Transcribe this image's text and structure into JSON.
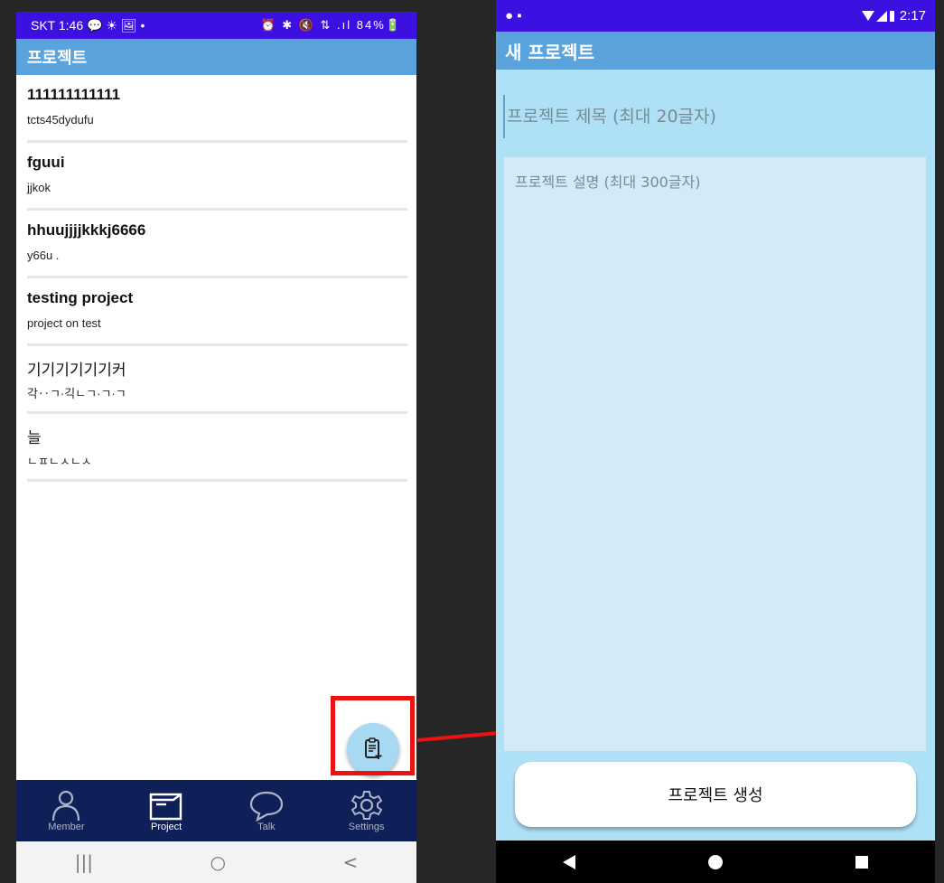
{
  "left": {
    "status": {
      "time": "SKT 1:46",
      "indicators": "💬 ☀ 🖼 •",
      "right": "⏰ ✱ 🔇 ⇅ .ıl 84%🔋"
    },
    "title": "프로젝트",
    "projects": [
      {
        "title": "111111111111",
        "desc": "tcts45dydufu"
      },
      {
        "title": "fguui",
        "desc": "jjkok"
      },
      {
        "title": "hhuujjjjkkkj6666",
        "desc": "y66u ."
      },
      {
        "title": "testing project",
        "desc": "project on test"
      },
      {
        "title": "기기기기기기커",
        "desc": "각‥ㄱ·긱ㄴㄱ·ㄱ·ㄱ"
      },
      {
        "title": "늘",
        "desc": "ㄴㅍㄴㅅㄴㅅ"
      }
    ],
    "fab_icon": "add-document-icon",
    "nav": [
      {
        "label": "Member",
        "icon": "person-icon"
      },
      {
        "label": "Project",
        "icon": "folder-icon"
      },
      {
        "label": "Talk",
        "icon": "chat-bubble-icon"
      },
      {
        "label": "Settings",
        "icon": "gear-icon"
      }
    ],
    "system_nav": {
      "recent": "|||",
      "home": "○",
      "back": "<"
    }
  },
  "right": {
    "status": {
      "time": "2:17",
      "left_icons": "● ▪"
    },
    "title": "새 프로젝트",
    "title_placeholder": "프로젝트 제목 (최대 20글자)",
    "desc_placeholder": "프로젝트 설명 (최대 300글자)",
    "create_label": "프로젝트 생성"
  },
  "colors": {
    "status_bar": "#3b10e0",
    "app_bar": "#5aa3dc",
    "bottom_nav": "#0f1f57",
    "form_bg": "#aee0f6",
    "highlight": "#ee1111"
  }
}
